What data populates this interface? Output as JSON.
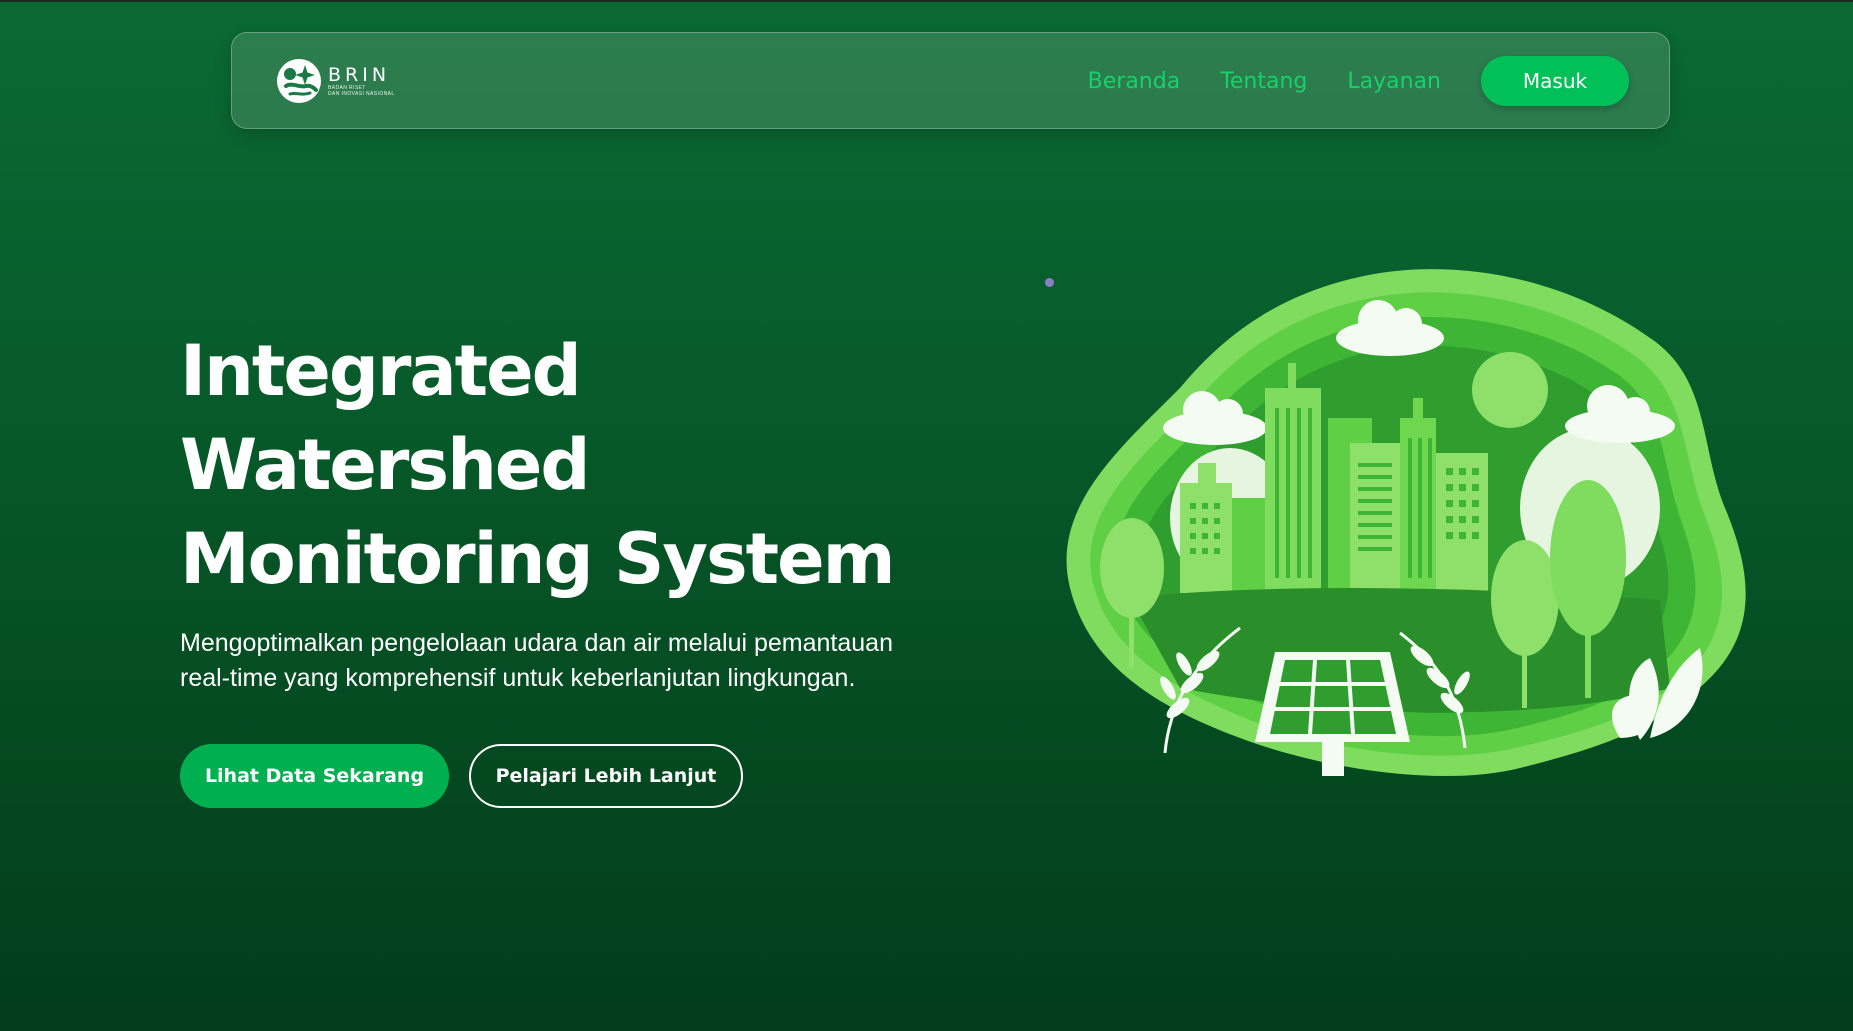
{
  "navbar": {
    "logo": {
      "brand": "BRIN",
      "subtitle_line1": "BADAN RISET",
      "subtitle_line2": "DAN INOVASI NASIONAL"
    },
    "links": [
      "Beranda",
      "Tentang",
      "Layanan"
    ],
    "login_label": "Masuk"
  },
  "hero": {
    "title_line1": "Integrated",
    "title_line2": "Watershed",
    "title_line3": "Monitoring System",
    "subtitle_line1": "Mengoptimalkan pengelolaan udara dan air melalui pemantauan",
    "subtitle_line2": "real-time yang komprehensif untuk keberlanjutan lingkungan.",
    "primary_button": "Lihat Data Sekarang",
    "secondary_button": "Pelajari Lebih Lanjut"
  },
  "illustration": {
    "name": "green-city-papercut-illustration",
    "elements": [
      "clouds",
      "sun",
      "city-buildings",
      "trees",
      "solar-panel",
      "leaves"
    ]
  },
  "colors": {
    "background_top": "#0b6a33",
    "background_bottom": "#033c1b",
    "nav_link": "#18d16a",
    "primary_button": "#00b050",
    "login_button": "#00c057",
    "illustration_dark": "#2f9e2f",
    "illustration_light": "#7fdc5f"
  }
}
